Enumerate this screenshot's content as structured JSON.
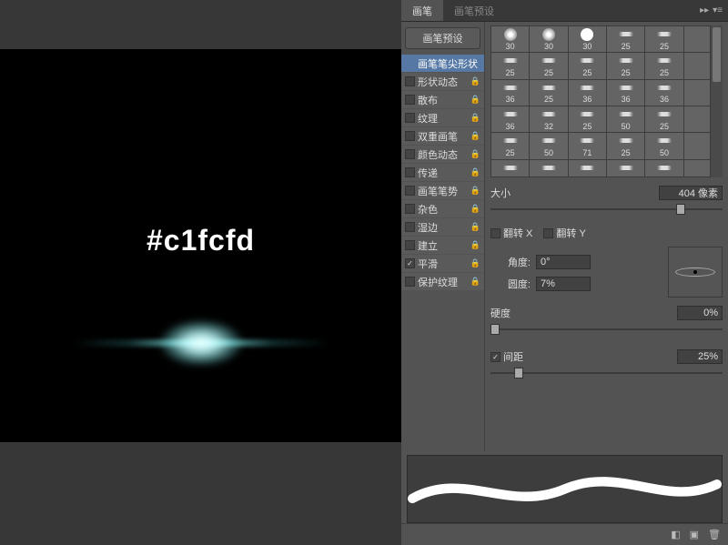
{
  "tabs": {
    "brush": "画笔",
    "presets": "画笔预设"
  },
  "preset_button": "画笔预设",
  "options": [
    {
      "id": "tip",
      "label": "画笔笔尖形状",
      "cb": null,
      "active": true
    },
    {
      "id": "shape-dyn",
      "label": "形状动态",
      "cb": false
    },
    {
      "id": "scatter",
      "label": "散布",
      "cb": false
    },
    {
      "id": "texture",
      "label": "纹理",
      "cb": false
    },
    {
      "id": "dual",
      "label": "双重画笔",
      "cb": false
    },
    {
      "id": "color-dyn",
      "label": "颜色动态",
      "cb": false
    },
    {
      "id": "transfer",
      "label": "传递",
      "cb": false
    },
    {
      "id": "pose",
      "label": "画笔笔势",
      "cb": false
    },
    {
      "id": "noise",
      "label": "杂色",
      "cb": false
    },
    {
      "id": "wet",
      "label": "湿边",
      "cb": false
    },
    {
      "id": "build",
      "label": "建立",
      "cb": false
    },
    {
      "id": "smooth",
      "label": "平滑",
      "cb": true
    },
    {
      "id": "protect",
      "label": "保护纹理",
      "cb": false
    }
  ],
  "thumbs": [
    {
      "s": "30",
      "t": "soft"
    },
    {
      "s": "30",
      "t": "soft"
    },
    {
      "s": "30",
      "t": "hard"
    },
    {
      "s": "25",
      "t": "flat"
    },
    {
      "s": "25",
      "t": "flat"
    },
    {
      "s": "",
      "t": ""
    },
    {
      "s": "25",
      "t": "flat"
    },
    {
      "s": "25",
      "t": "flat"
    },
    {
      "s": "25",
      "t": "flat"
    },
    {
      "s": "25",
      "t": "flat"
    },
    {
      "s": "25",
      "t": "flat"
    },
    {
      "s": "",
      "t": ""
    },
    {
      "s": "36",
      "t": "flat"
    },
    {
      "s": "25",
      "t": "flat"
    },
    {
      "s": "36",
      "t": "flat"
    },
    {
      "s": "36",
      "t": "flat"
    },
    {
      "s": "36",
      "t": "flat"
    },
    {
      "s": "",
      "t": ""
    },
    {
      "s": "36",
      "t": "flat"
    },
    {
      "s": "32",
      "t": "flat"
    },
    {
      "s": "25",
      "t": "flat"
    },
    {
      "s": "50",
      "t": "flat"
    },
    {
      "s": "25",
      "t": "flat"
    },
    {
      "s": "",
      "t": ""
    },
    {
      "s": "25",
      "t": "flat"
    },
    {
      "s": "50",
      "t": "flat"
    },
    {
      "s": "71",
      "t": "flat"
    },
    {
      "s": "25",
      "t": "flat"
    },
    {
      "s": "50",
      "t": "flat"
    },
    {
      "s": "",
      "t": ""
    },
    {
      "s": "",
      "t": "flat"
    },
    {
      "s": "",
      "t": "flat"
    },
    {
      "s": "",
      "t": "flat"
    },
    {
      "s": "",
      "t": "flat"
    },
    {
      "s": "",
      "t": "flat"
    },
    {
      "s": "",
      "t": ""
    }
  ],
  "controls": {
    "size_label": "大小",
    "size_value": "404 像素",
    "flipx": "翻转 X",
    "flipy": "翻转 Y",
    "angle_label": "角度:",
    "angle_value": "0°",
    "round_label": "圆度:",
    "round_value": "7%",
    "hardness_label": "硬度",
    "hardness_value": "0%",
    "spacing_label": "间距",
    "spacing_value": "25%"
  },
  "canvas_text": "#c1fcfd"
}
